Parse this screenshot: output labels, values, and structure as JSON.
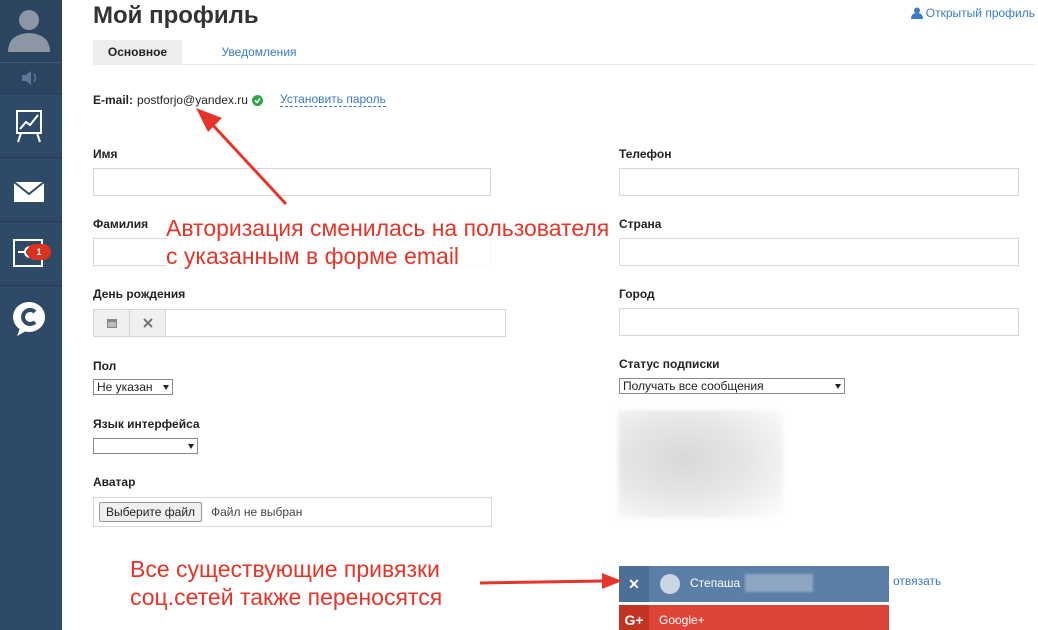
{
  "header": {
    "title": "Мой профиль",
    "open_profile": "Открытый профиль"
  },
  "tabs": [
    {
      "label": "Основное",
      "active": true
    },
    {
      "label": "Уведомления",
      "active": false
    }
  ],
  "sidebar": {
    "badge_count": "1",
    "items": [
      "stats-icon",
      "mail-icon",
      "settings-icon",
      "logo-icon"
    ]
  },
  "email": {
    "label": "E-mail:",
    "value": "postforjo@yandex.ru",
    "set_password": "Установить пароль"
  },
  "form": {
    "name_label": "Имя",
    "surname_label": "Фамилия",
    "birthday_label": "День рождения",
    "gender_label": "Пол",
    "gender_value": "Не указан",
    "language_label": "Язык интерфейса",
    "language_value": "",
    "avatar_label": "Аватар",
    "file_button": "Выберите файл",
    "file_status": "Файл не выбран",
    "phone_label": "Телефон",
    "country_label": "Страна",
    "city_label": "Город",
    "subscription_label": "Статус подписки",
    "subscription_value": "Получать все сообщения"
  },
  "social": {
    "vk_name": "Степаша",
    "unlink": "отвязать",
    "google_label": "Google+"
  },
  "annotations": {
    "top_line1": "Авторизация сменилась на пользователя",
    "top_line2": "с указанным в форме email",
    "bottom_line1": "Все существующие привязки",
    "bottom_line2": "соц.сетей также переносятся"
  },
  "colors": {
    "sidebar": "#2f4a66",
    "link": "#3a7bc8",
    "annotation": "#e53529",
    "vk": "#5b7fa6",
    "google": "#db4437"
  }
}
